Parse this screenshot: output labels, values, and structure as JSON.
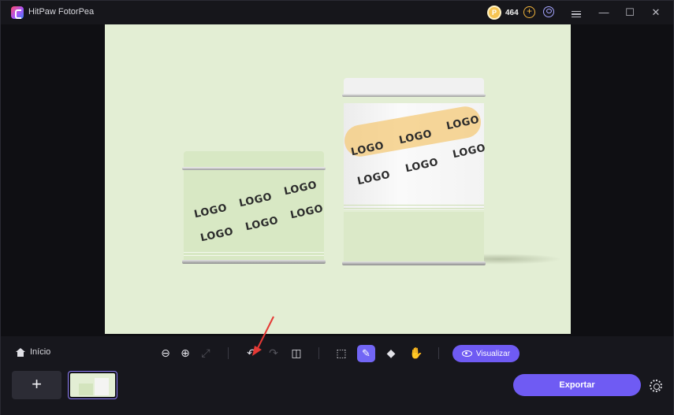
{
  "app": {
    "title": "HitPaw FotorPea"
  },
  "titlebar": {
    "coin_symbol": "P",
    "coin_count": "464",
    "add_coin_symbol": "+",
    "minimize_symbol": "—",
    "maximize_symbol": "☐",
    "close_symbol": "✕",
    "icons": [
      "coin-icon",
      "add-coin-icon",
      "user-icon",
      "menu-icon",
      "minimize-icon",
      "maximize-icon",
      "close-icon"
    ]
  },
  "canvas": {
    "background_color": "#e3eed4",
    "small_tin_logos": [
      "LOGO",
      "LOGO",
      "LOGO",
      "LOGO",
      "LOGO",
      "LOGO"
    ],
    "tall_tin_logos": [
      "LOGO",
      "LOGO",
      "LOGO",
      "LOGO",
      "LOGO",
      "LOGO"
    ],
    "brush_highlight_color": "#f4c978"
  },
  "toolbar": {
    "home_label": "Início",
    "zoom_out_symbol": "⊖",
    "zoom_in_symbol": "⊕",
    "fit_symbol": "⤢",
    "undo_symbol": "↶",
    "redo_symbol": "↷",
    "compare_symbol": "◫",
    "ai_select_symbol": "⬚",
    "brush_symbol": "✎",
    "eraser_symbol": "◆",
    "hand_symbol": "✋",
    "preview_label": "Visualizar",
    "accent_color": "#6f5bf3"
  },
  "bottom": {
    "add_symbol": "+",
    "export_label": "Exportar"
  }
}
